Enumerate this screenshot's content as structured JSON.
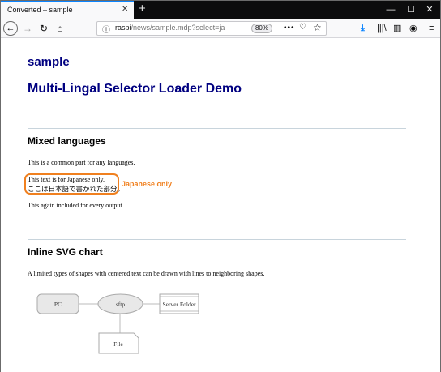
{
  "browser": {
    "tab_title": "Converted – sample",
    "tab_close": "✕",
    "new_tab": "+",
    "window_minimize": "—",
    "window_maximize": "☐",
    "window_close": "✕",
    "url_host": "raspi",
    "url_path": "/news/sample.mdp?select=ja",
    "zoom": "80%",
    "page_actions": "•••",
    "icons": [
      "back-icon",
      "forward-icon",
      "reload-icon",
      "home-icon",
      "info-icon",
      "pocket-icon",
      "bookmark-star-icon",
      "download-icon",
      "library-icon",
      "sidebar-icon",
      "account-icon",
      "menu-icon"
    ]
  },
  "page": {
    "title": "sample",
    "heading": "Multi-Lingal Selector Loader Demo",
    "section1": {
      "heading": "Mixed languages",
      "common_text": "This is a common part for any languages.",
      "ja_line1": "This text is for Japanese only.",
      "ja_line2": "ここは日本語で書かれた部分。",
      "ja_annotation": "Japanese only",
      "again_text": "This again included for every output."
    },
    "section2": {
      "heading": "Inline SVG chart",
      "description": "A limited types of shapes with centered text can be drawn with lines to neighboring shapes.",
      "nodes": {
        "pc": "PC",
        "sftp": "sftp",
        "server_folder": "Server Folder",
        "file": "File"
      }
    }
  },
  "colors": {
    "title_color": "#000080",
    "annotation_color": "#f0801f",
    "tab_accent": "#0a84ff"
  }
}
